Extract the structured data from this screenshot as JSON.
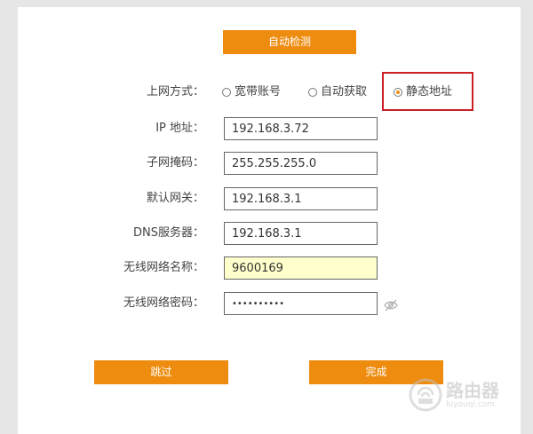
{
  "buttons": {
    "detect_label": "自动检测",
    "skip_label": "跳过",
    "done_label": "完成"
  },
  "connection": {
    "label": "上网方式：",
    "options": [
      {
        "label": "宽带账号",
        "selected": false
      },
      {
        "label": "自动获取",
        "selected": false
      },
      {
        "label": "静态地址",
        "selected": true
      }
    ]
  },
  "fields": {
    "ip": {
      "label": "IP 地址：",
      "value": "192.168.3.72"
    },
    "mask": {
      "label": "子网掩码：",
      "value": "255.255.255.0"
    },
    "gateway": {
      "label": "默认网关：",
      "value": "192.168.3.1"
    },
    "dns": {
      "label": "DNS服务器：",
      "value": "192.168.3.1"
    },
    "ssid": {
      "label": "无线网络名称：",
      "value": "9600169"
    },
    "wifi_password": {
      "label": "无线网络密码：",
      "value": "••••••••••"
    }
  },
  "watermark": {
    "name": "路由器",
    "url": "luyouqi.com"
  },
  "colors": {
    "accent": "#ee8c10",
    "highlight": "#cc1f26",
    "ssid_bg": "#ffffcc"
  }
}
